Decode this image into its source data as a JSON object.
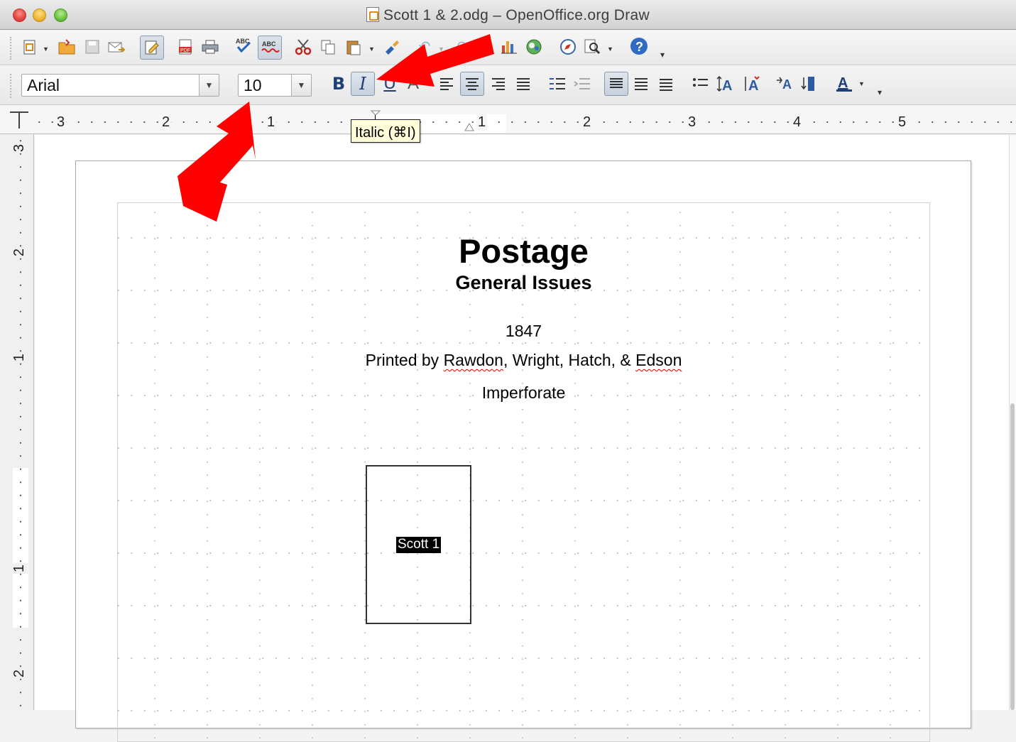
{
  "window": {
    "title": "Scott 1 & 2.odg – OpenOffice.org Draw"
  },
  "toolbar_standard": {
    "icons": [
      "new-icon",
      "open-icon",
      "save-icon",
      "email-icon",
      "edit-file-icon",
      "export-pdf-icon",
      "print-icon",
      "spellcheck-icon",
      "autospellcheck-icon",
      "cut-icon",
      "copy-icon",
      "paste-icon",
      "clone-formatting-icon",
      "undo-icon",
      "redo-icon",
      "chart-icon",
      "gallery-icon",
      "navigator-icon",
      "zoom-icon",
      "help-icon"
    ]
  },
  "toolbar_formatting": {
    "font_name": "Arial",
    "font_size": "10",
    "bold_label": "B",
    "italic_label": "I",
    "italic_pressed": true,
    "align_center_pressed": true
  },
  "tooltip": {
    "text": "Italic (⌘I)"
  },
  "rulers": {
    "horizontal_numbers": [
      "3",
      "2",
      "1",
      "1",
      "2",
      "3",
      "4",
      "5"
    ],
    "vertical_numbers": [
      "3",
      "2",
      "1",
      "1",
      "2"
    ]
  },
  "document": {
    "title": "Postage",
    "subtitle": "General Issues",
    "year": "1847",
    "printer_prefix": "Printed by ",
    "printer_name1": "Rawdon",
    "printer_middle": ", Wright, Hatch, & ",
    "printer_name2": "Edson",
    "note": "Imperforate",
    "stamp_label": "Scott 1"
  },
  "colors": {
    "annotation_arrow": "#ff0000",
    "spelling_underline": "#e00000",
    "tooltip_bg": "#fffed8"
  }
}
